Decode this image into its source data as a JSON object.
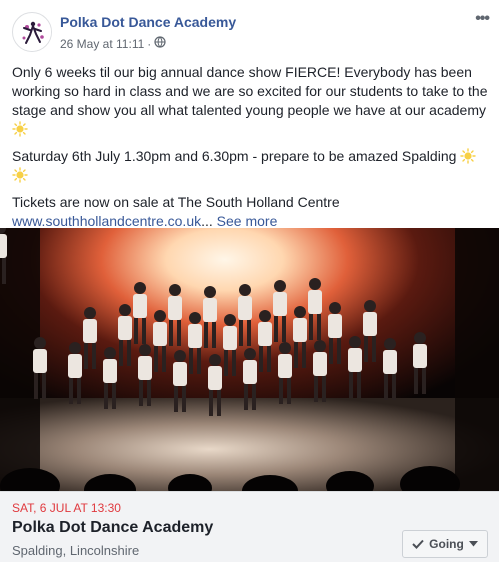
{
  "post": {
    "page_name": "Polka Dot Dance Academy",
    "timestamp": "26 May at 11:11",
    "separator": "·",
    "privacy_icon": "globe-icon",
    "more_icon": "more-options-icon"
  },
  "body": {
    "paragraph1": "Only 6 weeks til our big annual dance show FIERCE! Everybody has been working so hard in class and we are so excited for our students to take to the stage and show you all what talented young people we have at our academy",
    "paragraph2": "Saturday 6th July 1.30pm and 6.30pm - prepare to be amazed Spalding",
    "paragraph3": "Tickets are now on sale at The South Holland Centre",
    "link_text": "www.southhollandcentre.co.uk",
    "ellipsis": "...",
    "see_more": "See more",
    "emoji_icon": "sun-emoji-icon"
  },
  "event": {
    "date": "SAT, 6 JUL AT 13:30",
    "title": "Polka Dot Dance Academy",
    "location": "Spalding, Lincolnshire",
    "going_label": "Going",
    "going_check_icon": "check-icon",
    "going_caret_icon": "caret-down-icon"
  },
  "colors": {
    "link_blue": "#385898",
    "date_red": "#e0393e",
    "text": "#1d2129",
    "meta_grey": "#606770"
  }
}
